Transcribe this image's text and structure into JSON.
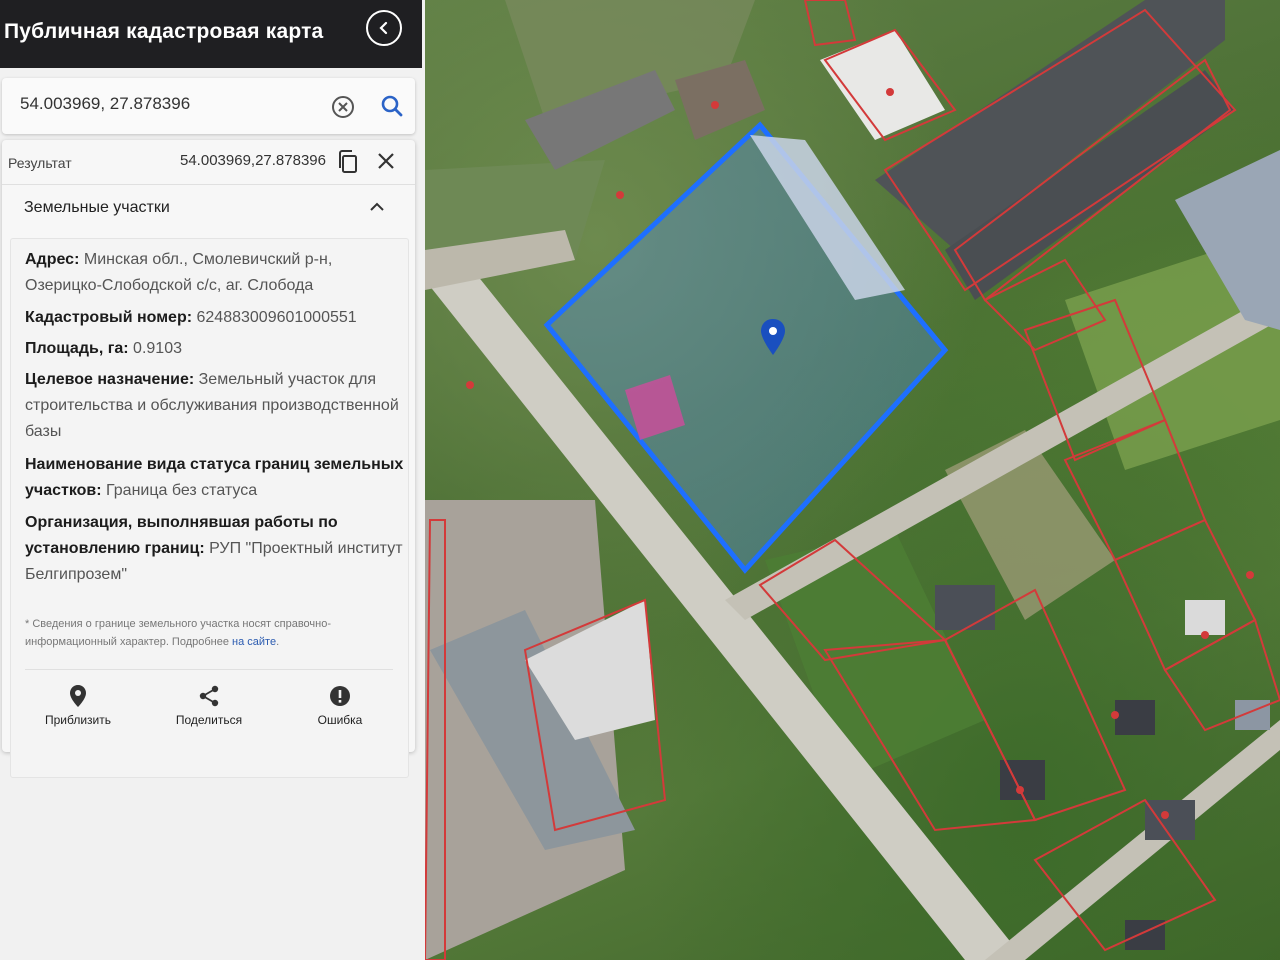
{
  "app": {
    "title": "Публичная кадастровая карта"
  },
  "search": {
    "value": "54.003969, 27.878396",
    "placeholder": ""
  },
  "result": {
    "label": "Результат",
    "coords": "54.003969,27.878396",
    "section_title": "Земельные участки",
    "fields": [
      {
        "key": "Адрес:",
        "value": "Минская обл., Смолевичский р-н, Озерицко-Слободской с/с, аг. Слобода"
      },
      {
        "key": "Кадастровый номер:",
        "value": "624883009601000551"
      },
      {
        "key": "Площадь, га:",
        "value": "0.9103"
      },
      {
        "key": "Целевое назначение:",
        "value": "Земельный участок для строительства и обслуживания производственной базы"
      },
      {
        "key": "Наименование вида статуса границ земельных участков:",
        "value": "Граница без статуса"
      },
      {
        "key": "Организация, выполнявшая работы по установлению границ:",
        "value": "РУП \"Проектный институт Белгипрозем\""
      }
    ],
    "disclaimer": "* Сведения о границе земельного участка носят справочно-информационный характер. Подробнее",
    "disclaimer_link": "на сайте",
    "disclaimer_end": ".",
    "actions": [
      {
        "label": "Приблизить",
        "icon": "location-pin-icon"
      },
      {
        "label": "Поделиться",
        "icon": "share-icon"
      },
      {
        "label": "Ошибка",
        "icon": "error-icon"
      }
    ]
  },
  "colors": {
    "topbar": "#1f1f22",
    "selected_parcel": "#1e6fff",
    "parcel_border": "#d33a3a",
    "marker": "#1a4fbf"
  }
}
